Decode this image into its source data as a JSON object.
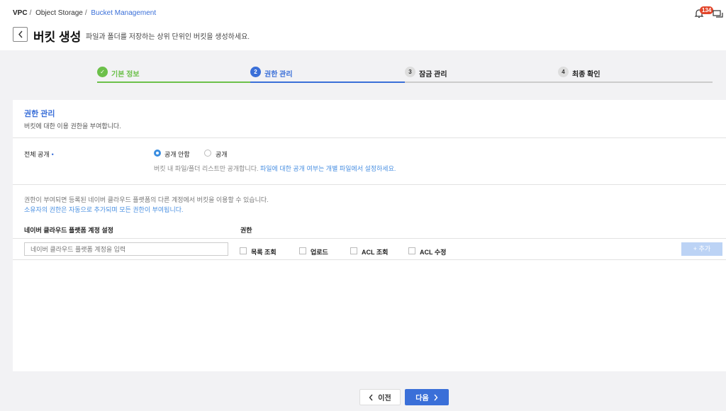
{
  "breadcrumb": {
    "items": [
      "VPC",
      "Object Storage",
      "Bucket Management"
    ],
    "separator": "/"
  },
  "header": {
    "title": "버킷 생성",
    "subtitle": "파일과 폴더를 저장하는 상위 단위인 버킷을 생성하세요."
  },
  "notifications": {
    "count": "134"
  },
  "stepper": {
    "steps": [
      {
        "num": "✓",
        "label": "기본 정보",
        "state": "done"
      },
      {
        "num": "2",
        "label": "권한 관리",
        "state": "active"
      },
      {
        "num": "3",
        "label": "잠금 관리",
        "state": "todo"
      },
      {
        "num": "4",
        "label": "최종 확인",
        "state": "todo"
      }
    ]
  },
  "section": {
    "title": "권한 관리",
    "description": "버킷에 대한 이용 권한을 부여합니다."
  },
  "public_access": {
    "label": "전체 공개",
    "required_mark": "•",
    "options": [
      {
        "label": "공개 안함",
        "selected": true
      },
      {
        "label": "공개",
        "selected": false
      }
    ],
    "hint_gray": "버킷 내 파일/폴더 리스트만 공개합니다. ",
    "hint_blue": "파일에 대한 공개 여부는 개별 파일에서 설정하세요."
  },
  "info": {
    "line1": "권한이 부여되면 등록된 네이버 클라우드 플랫폼의 다른 계정에서 버킷을 이용할 수 있습니다.",
    "line2": "소유자의 권한은 자동으로 추가되며 모든 권한이 부여됩니다."
  },
  "permissions_table": {
    "headers": {
      "account": "네이버 클라우드 플랫폼 계정 설정",
      "permission": "권한"
    },
    "account_placeholder": "네이버 클라우드 플랫폼 계정을 입력",
    "checkboxes": [
      "목록 조회",
      "업로드",
      "ACL 조회",
      "ACL 수정"
    ],
    "add_label": "+ 추가"
  },
  "footer": {
    "prev_label": "이전",
    "next_label": "다음"
  },
  "colors": {
    "accent": "#3a6fd8",
    "done": "#6cc04a",
    "badge": "#e2452a"
  }
}
